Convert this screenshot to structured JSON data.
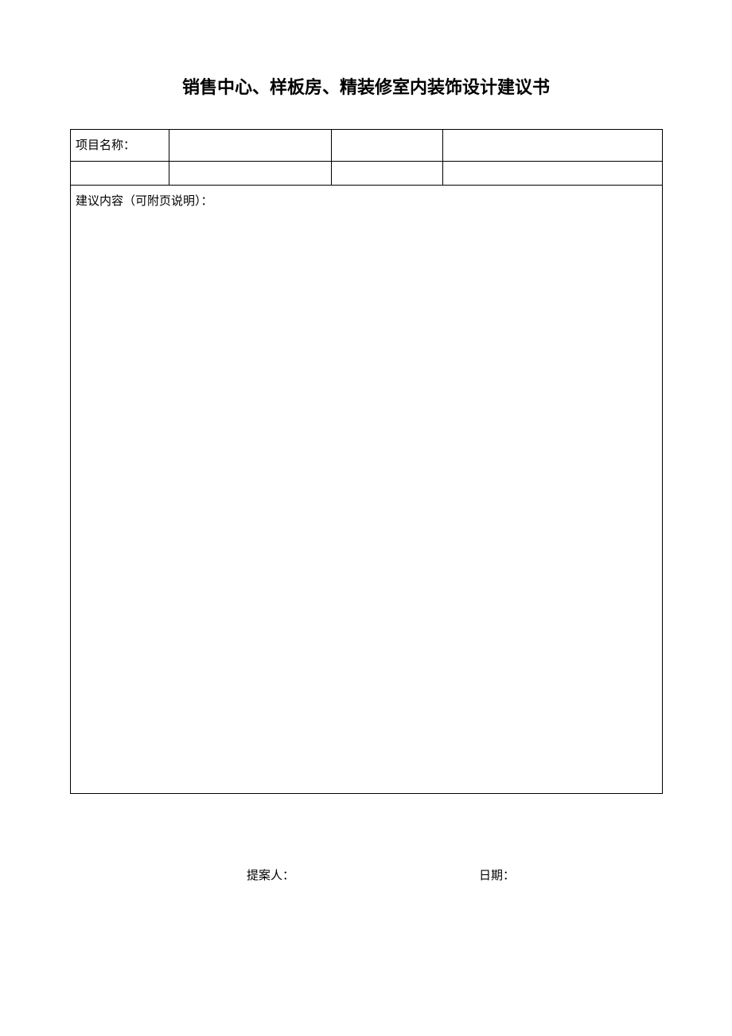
{
  "title": "销售中心、样板房、精装修室内装饰设计建议书",
  "form": {
    "project_name_label": "项目名称：",
    "project_name_value": "",
    "cell_r1_c3": "",
    "cell_r1_c4": "",
    "cell_r2_c1": "",
    "cell_r2_c2": "",
    "cell_r2_c3": "",
    "cell_r2_c4": "",
    "content_label": "建议内容（可附页说明）：",
    "content_value": ""
  },
  "footer": {
    "proposer_label": "提案人：",
    "proposer_value": "",
    "date_label": "日期：",
    "date_value": ""
  }
}
